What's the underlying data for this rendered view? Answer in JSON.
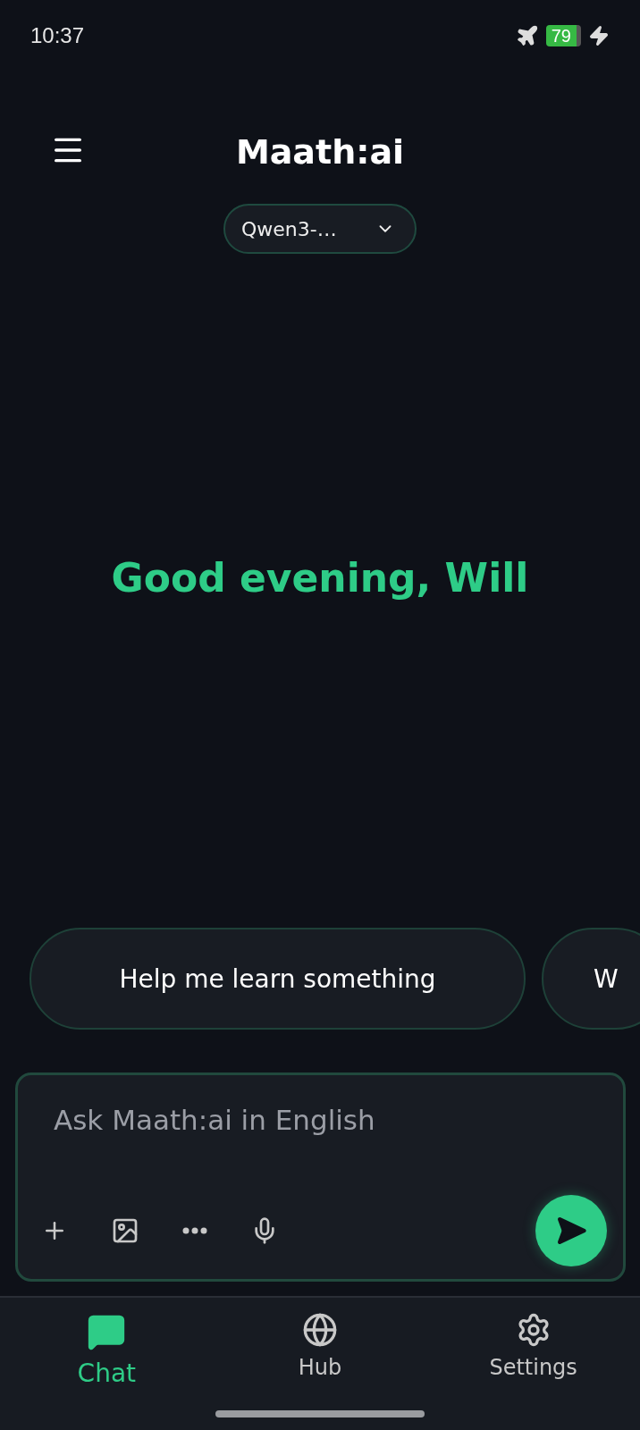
{
  "status_bar": {
    "time": "10:37",
    "battery": "79"
  },
  "header": {
    "title": "Maath:ai",
    "model_selector": "Qwen3-…"
  },
  "greeting": "Good evening, Will",
  "suggestions": [
    "Help me learn something",
    "W"
  ],
  "composer": {
    "placeholder": "Ask Maath:ai in English",
    "tools": [
      {
        "kind": "plus"
      },
      {
        "kind": "image"
      },
      {
        "kind": "more"
      },
      {
        "kind": "mic"
      }
    ]
  },
  "bottom_nav": [
    {
      "label": "Chat",
      "kind": "chat",
      "selected": true
    },
    {
      "label": "Hub",
      "kind": "globe",
      "selected": false
    },
    {
      "label": "Settings",
      "kind": "gear",
      "selected": false
    }
  ]
}
